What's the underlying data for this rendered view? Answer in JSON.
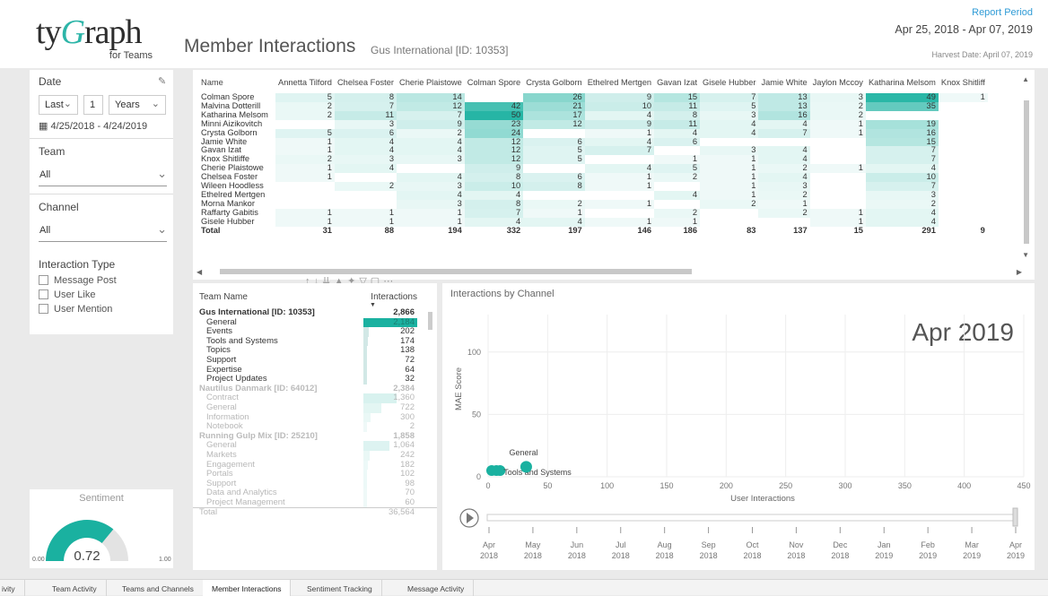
{
  "header": {
    "logo_text_a": "ty",
    "logo_text_g": "G",
    "logo_text_b": "raph",
    "logo_sub": "for Teams",
    "title": "Member Interactions",
    "subtitle": "Gus International [ID: 10353]",
    "report_period_label": "Report Period",
    "report_period": "Apr 25, 2018 - Apr 07, 2019",
    "harvest_date": "Harvest Date: April 07, 2019"
  },
  "filters": {
    "date_label": "Date",
    "date_mode": "Last",
    "date_count": "1",
    "date_unit": "Years",
    "date_range": "4/25/2018 - 4/24/2019",
    "team_label": "Team",
    "team_value": "All",
    "channel_label": "Channel",
    "channel_value": "All",
    "interaction_type_label": "Interaction Type",
    "interaction_types": [
      "Message Post",
      "User Like",
      "User Mention"
    ]
  },
  "sentiment": {
    "title": "Sentiment",
    "value": "0.72",
    "min": "0.00",
    "max": "1.00",
    "fraction": 0.72,
    "color": "#1ab1a0"
  },
  "matrix": {
    "columns": [
      "Name",
      "Annetta Tilford",
      "Chelsea Foster",
      "Cherie Plaistowe",
      "Colman Spore",
      "Crysta Golborn",
      "Ethelred Mertgen",
      "Gavan Izat",
      "Gisele Hubber",
      "Jamie White",
      "Jaylon Mccoy",
      "Katharina Melsom",
      "Knox Shitliff"
    ],
    "rows": [
      [
        "Colman Spore",
        "5",
        "8",
        "14",
        "",
        "26",
        "9",
        "15",
        "7",
        "13",
        "3",
        "49",
        "1"
      ],
      [
        "Malvina Dotterill",
        "2",
        "7",
        "12",
        "42",
        "21",
        "10",
        "11",
        "5",
        "13",
        "2",
        "35",
        ""
      ],
      [
        "Katharina Melsom",
        "2",
        "11",
        "7",
        "50",
        "17",
        "4",
        "8",
        "3",
        "16",
        "2",
        "",
        ""
      ],
      [
        "Minni Aizikovitch",
        "",
        "3",
        "9",
        "23",
        "12",
        "9",
        "11",
        "4",
        "4",
        "1",
        "19",
        ""
      ],
      [
        "Crysta Golborn",
        "5",
        "6",
        "2",
        "24",
        "",
        "1",
        "4",
        "4",
        "7",
        "1",
        "16",
        ""
      ],
      [
        "Jamie White",
        "1",
        "4",
        "4",
        "12",
        "6",
        "4",
        "6",
        "",
        "",
        "",
        "15",
        ""
      ],
      [
        "Gavan Izat",
        "1",
        "4",
        "4",
        "12",
        "5",
        "7",
        "",
        "3",
        "4",
        "",
        "7",
        ""
      ],
      [
        "Knox Shitliffe",
        "2",
        "3",
        "3",
        "12",
        "5",
        "",
        "1",
        "1",
        "4",
        "",
        "7",
        ""
      ],
      [
        "Cherie Plaistowe",
        "1",
        "4",
        "",
        "9",
        "",
        "4",
        "5",
        "1",
        "2",
        "1",
        "4",
        ""
      ],
      [
        "Chelsea Foster",
        "1",
        "",
        "4",
        "8",
        "6",
        "1",
        "2",
        "1",
        "4",
        "",
        "10",
        ""
      ],
      [
        "Wileen Hoodless",
        "",
        "2",
        "3",
        "10",
        "8",
        "1",
        "",
        "1",
        "3",
        "",
        "7",
        ""
      ],
      [
        "Ethelred Mertgen",
        "",
        "",
        "4",
        "4",
        "",
        "",
        "4",
        "1",
        "2",
        "",
        "3",
        ""
      ],
      [
        "Morna Mankor",
        "",
        "",
        "3",
        "8",
        "2",
        "1",
        "",
        "2",
        "1",
        "",
        "2",
        ""
      ],
      [
        "Raffarty Gabitis",
        "1",
        "1",
        "1",
        "7",
        "1",
        "",
        "2",
        "",
        "2",
        "1",
        "4",
        ""
      ],
      [
        "Gisele Hubber",
        "1",
        "1",
        "1",
        "4",
        "4",
        "1",
        "1",
        "",
        "",
        "1",
        "4",
        ""
      ]
    ],
    "total": [
      "Total",
      "31",
      "88",
      "194",
      "332",
      "197",
      "146",
      "186",
      "83",
      "137",
      "15",
      "291",
      "9"
    ],
    "heat_color": "#1ab1a0",
    "heat_max": 50
  },
  "team_table": {
    "col_team": "Team Name",
    "col_interactions": "Interactions",
    "rows": [
      {
        "name": "Gus International [ID: 10353]",
        "value": "2,866",
        "num": 2866,
        "level": "group",
        "faded": false
      },
      {
        "name": "General",
        "value": "2,184",
        "num": 2184,
        "level": "child",
        "faded": false
      },
      {
        "name": "Events",
        "value": "202",
        "num": 202,
        "level": "child",
        "faded": false
      },
      {
        "name": "Tools and Systems",
        "value": "174",
        "num": 174,
        "level": "child",
        "faded": false
      },
      {
        "name": "Topics",
        "value": "138",
        "num": 138,
        "level": "child",
        "faded": false
      },
      {
        "name": "Support",
        "value": "72",
        "num": 72,
        "level": "child",
        "faded": false
      },
      {
        "name": "Expertise",
        "value": "64",
        "num": 64,
        "level": "child",
        "faded": false
      },
      {
        "name": "Project Updates",
        "value": "32",
        "num": 32,
        "level": "child",
        "faded": false
      },
      {
        "name": "Nautilus Danmark [ID: 64012]",
        "value": "2,384",
        "num": 2384,
        "level": "group",
        "faded": true
      },
      {
        "name": "Contract",
        "value": "1,360",
        "num": 1360,
        "level": "child",
        "faded": true
      },
      {
        "name": "General",
        "value": "722",
        "num": 722,
        "level": "child",
        "faded": true
      },
      {
        "name": "Information",
        "value": "300",
        "num": 300,
        "level": "child",
        "faded": true
      },
      {
        "name": "Notebook",
        "value": "2",
        "num": 2,
        "level": "child",
        "faded": true
      },
      {
        "name": "Running Gulp Mix [ID: 25210]",
        "value": "1,858",
        "num": 1858,
        "level": "group",
        "faded": true
      },
      {
        "name": "General",
        "value": "1,064",
        "num": 1064,
        "level": "child",
        "faded": true
      },
      {
        "name": "Markets",
        "value": "242",
        "num": 242,
        "level": "child",
        "faded": true
      },
      {
        "name": "Engagement",
        "value": "182",
        "num": 182,
        "level": "child",
        "faded": true
      },
      {
        "name": "Portals",
        "value": "102",
        "num": 102,
        "level": "child",
        "faded": true
      },
      {
        "name": "Support",
        "value": "98",
        "num": 98,
        "level": "child",
        "faded": true
      },
      {
        "name": "Data and Analytics",
        "value": "70",
        "num": 70,
        "level": "child",
        "faded": true
      },
      {
        "name": "Project Management",
        "value": "60",
        "num": 60,
        "level": "child",
        "faded": true
      },
      {
        "name": "Total",
        "value": "36,564",
        "num": 36564,
        "level": "total",
        "faded": true
      }
    ]
  },
  "scatter": {
    "title": "Interactions by Channel",
    "period_label": "Apr 2019",
    "xlabel": "User Interactions",
    "ylabel": "MAE Score",
    "x_ticks": [
      "0",
      "50",
      "100",
      "150",
      "200",
      "250",
      "300",
      "350",
      "400",
      "450"
    ],
    "y_ticks": [
      "0",
      "50",
      "100"
    ],
    "timeline_months": [
      "Apr",
      "May",
      "Jun",
      "Jul",
      "Aug",
      "Sep",
      "Oct",
      "Nov",
      "Dec",
      "Jan",
      "Feb",
      "Mar",
      "Apr"
    ],
    "timeline_years": [
      "2018",
      "2018",
      "2018",
      "2018",
      "2018",
      "2018",
      "2018",
      "2018",
      "2018",
      "2019",
      "2019",
      "2019",
      "2019"
    ]
  },
  "chart_data": {
    "type": "scatter",
    "title": "Interactions by Channel",
    "xlabel": "User Interactions",
    "ylabel": "MAE Score",
    "xlim": [
      0,
      450
    ],
    "ylim": [
      0,
      130
    ],
    "points": [
      {
        "label": "",
        "x": 3,
        "y": 5
      },
      {
        "label": "",
        "x": 7,
        "y": 5
      },
      {
        "label": "Tools and Systems",
        "x": 10,
        "y": 5
      },
      {
        "label": "General",
        "x": 32,
        "y": 8
      }
    ],
    "color": "#1ab1a0"
  },
  "tabs": [
    "ivity",
    "Team Activity",
    "Teams and Channels",
    "Member Interactions",
    "Sentiment Tracking",
    "Message Activity"
  ],
  "active_tab": 3
}
